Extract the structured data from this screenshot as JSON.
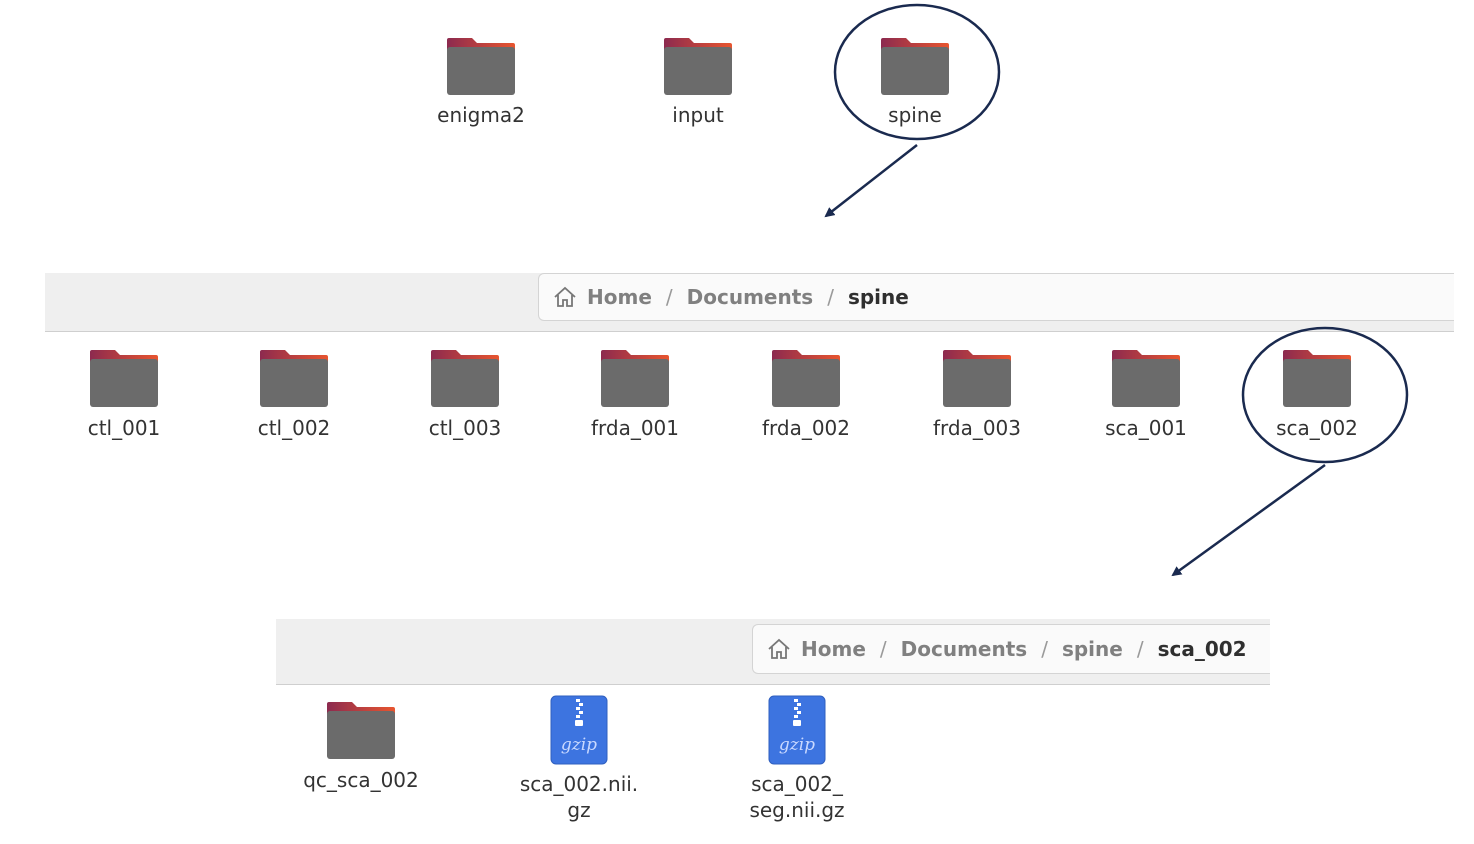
{
  "top_view": {
    "items": [
      {
        "label": "enigma2",
        "icon": "folder-icon"
      },
      {
        "label": "input",
        "icon": "folder-icon"
      },
      {
        "label": "spine",
        "icon": "folder-icon"
      }
    ]
  },
  "spine_view": {
    "breadcrumb": {
      "home_icon": "home-icon",
      "segments": [
        "Home",
        "Documents"
      ],
      "current": "spine",
      "separator": "/"
    },
    "items": [
      {
        "label": "ctl_001",
        "icon": "folder-icon"
      },
      {
        "label": "ctl_002",
        "icon": "folder-icon"
      },
      {
        "label": "ctl_003",
        "icon": "folder-icon"
      },
      {
        "label": "frda_001",
        "icon": "folder-icon"
      },
      {
        "label": "frda_002",
        "icon": "folder-icon"
      },
      {
        "label": "frda_003",
        "icon": "folder-icon"
      },
      {
        "label": "sca_001",
        "icon": "folder-icon"
      },
      {
        "label": "sca_002",
        "icon": "folder-icon"
      }
    ]
  },
  "sca_view": {
    "breadcrumb": {
      "home_icon": "home-icon",
      "segments": [
        "Home",
        "Documents",
        "spine"
      ],
      "current": "sca_002",
      "separator": "/"
    },
    "items": [
      {
        "label_lines": [
          "qc_sca_002"
        ],
        "icon": "folder-icon"
      },
      {
        "label_lines": [
          "sca_002.nii.",
          "gz"
        ],
        "icon": "gzip-archive-icon",
        "icon_text": "gzip"
      },
      {
        "label_lines": [
          "sca_002_",
          "seg.nii.gz"
        ],
        "icon": "gzip-archive-icon",
        "icon_text": "gzip"
      }
    ]
  },
  "colors": {
    "folder_body": "#6b6b6b",
    "folder_tab_start": "#8c2a4f",
    "folder_tab_end": "#e8552f",
    "archive_blue": "#3d74e0",
    "annotation": "#1a2a4f"
  }
}
